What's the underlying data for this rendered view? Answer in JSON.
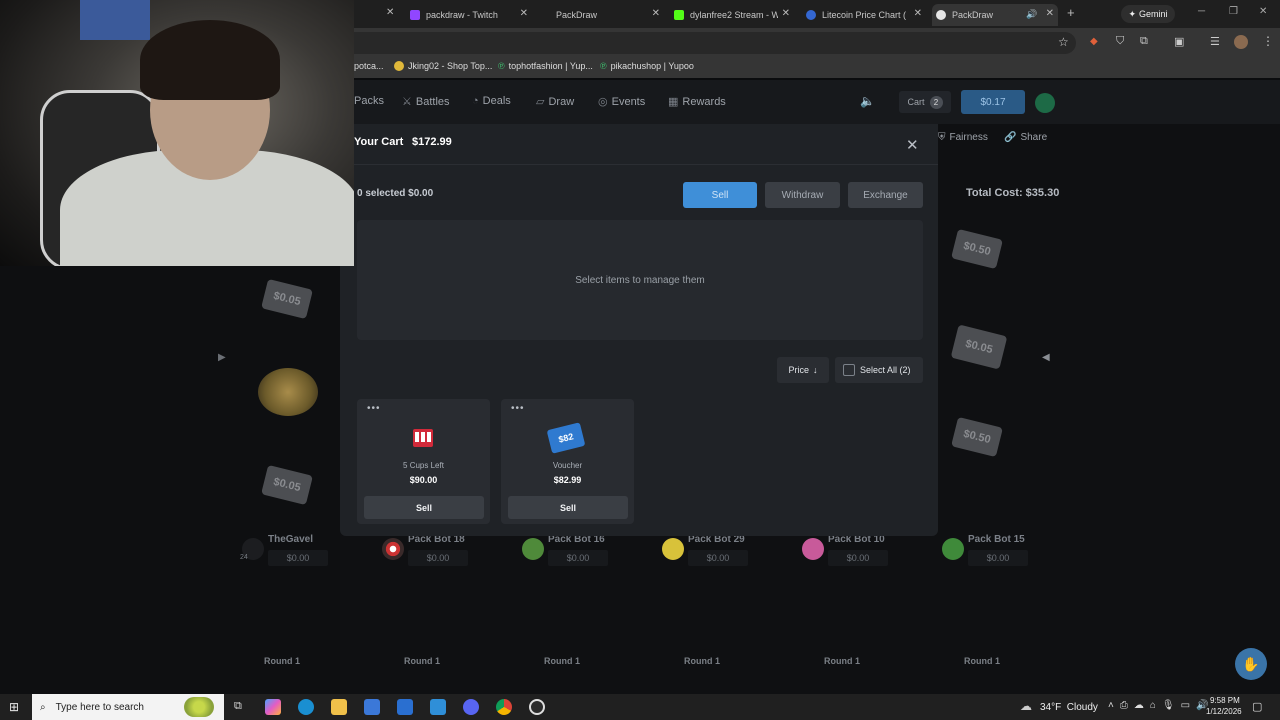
{
  "browser": {
    "tabs": [
      {
        "label": "packdraw - Twitch",
        "favicon_color": "#9146ff"
      },
      {
        "label": "PackDraw",
        "favicon_color": ""
      },
      {
        "label": "dylanfree2 Stream - Wa",
        "favicon_color": "#53fc18"
      },
      {
        "label": "Litecoin Price Chart (LTC",
        "favicon_color": "#3467d1"
      },
      {
        "label": "PackDraw",
        "favicon_color": "#ffffff"
      }
    ],
    "new_tab": "+",
    "gemini_label": "Gemini",
    "bookmarks": [
      {
        "label": "potca..."
      },
      {
        "label": "Jking02 - Shop Top..."
      },
      {
        "label": "tophotfashion | Yup..."
      },
      {
        "label": "pikachushop | Yupoo"
      }
    ]
  },
  "site_nav": {
    "items": [
      "Packs",
      "Battles",
      "Deals",
      "Draw",
      "Events",
      "Rewards"
    ],
    "cart_label": "Cart",
    "cart_count": "2",
    "balance": "$0.17"
  },
  "battle_header": {
    "fairness": "Fairness",
    "share": "Share",
    "total_cost": "Total Cost: $35.30"
  },
  "modal": {
    "title": "Your Cart",
    "total": "$172.99",
    "selected_info": "0 selected $0.00",
    "sell_button": "Sell",
    "withdraw_button": "Withdraw",
    "exchange_button": "Exchange",
    "empty_message": "Select items to manage them",
    "sort_label": "Price",
    "select_all_label": "Select All (2)",
    "items": [
      {
        "name": "5 Cups Left",
        "price": "$90.00",
        "button": "Sell"
      },
      {
        "name": "Voucher",
        "price": "$82.99",
        "button": "Sell"
      }
    ]
  },
  "reel_values": {
    "left": [
      "$0.05",
      "$0.05"
    ],
    "right": [
      "$0.50",
      "$0.05",
      "$0.50"
    ],
    "voucher_art": "$82"
  },
  "players": [
    {
      "name": "TheGavel",
      "value": "$0.00",
      "round": "Round 1",
      "level": "24"
    },
    {
      "name": "Pack Bot 18",
      "value": "$0.00",
      "round": "Round 1"
    },
    {
      "name": "Pack Bot 16",
      "value": "$0.00",
      "round": "Round 1"
    },
    {
      "name": "Pack Bot 29",
      "value": "$0.00",
      "round": "Round 1"
    },
    {
      "name": "Pack Bot 10",
      "value": "$0.00",
      "round": "Round 1"
    },
    {
      "name": "Pack Bot 15",
      "value": "$0.00",
      "round": "Round 1"
    }
  ],
  "taskbar": {
    "search_placeholder": "Type here to search",
    "weather": "34°F  Cloudy",
    "time": "9:58 PM",
    "date": "1/12/2026"
  }
}
